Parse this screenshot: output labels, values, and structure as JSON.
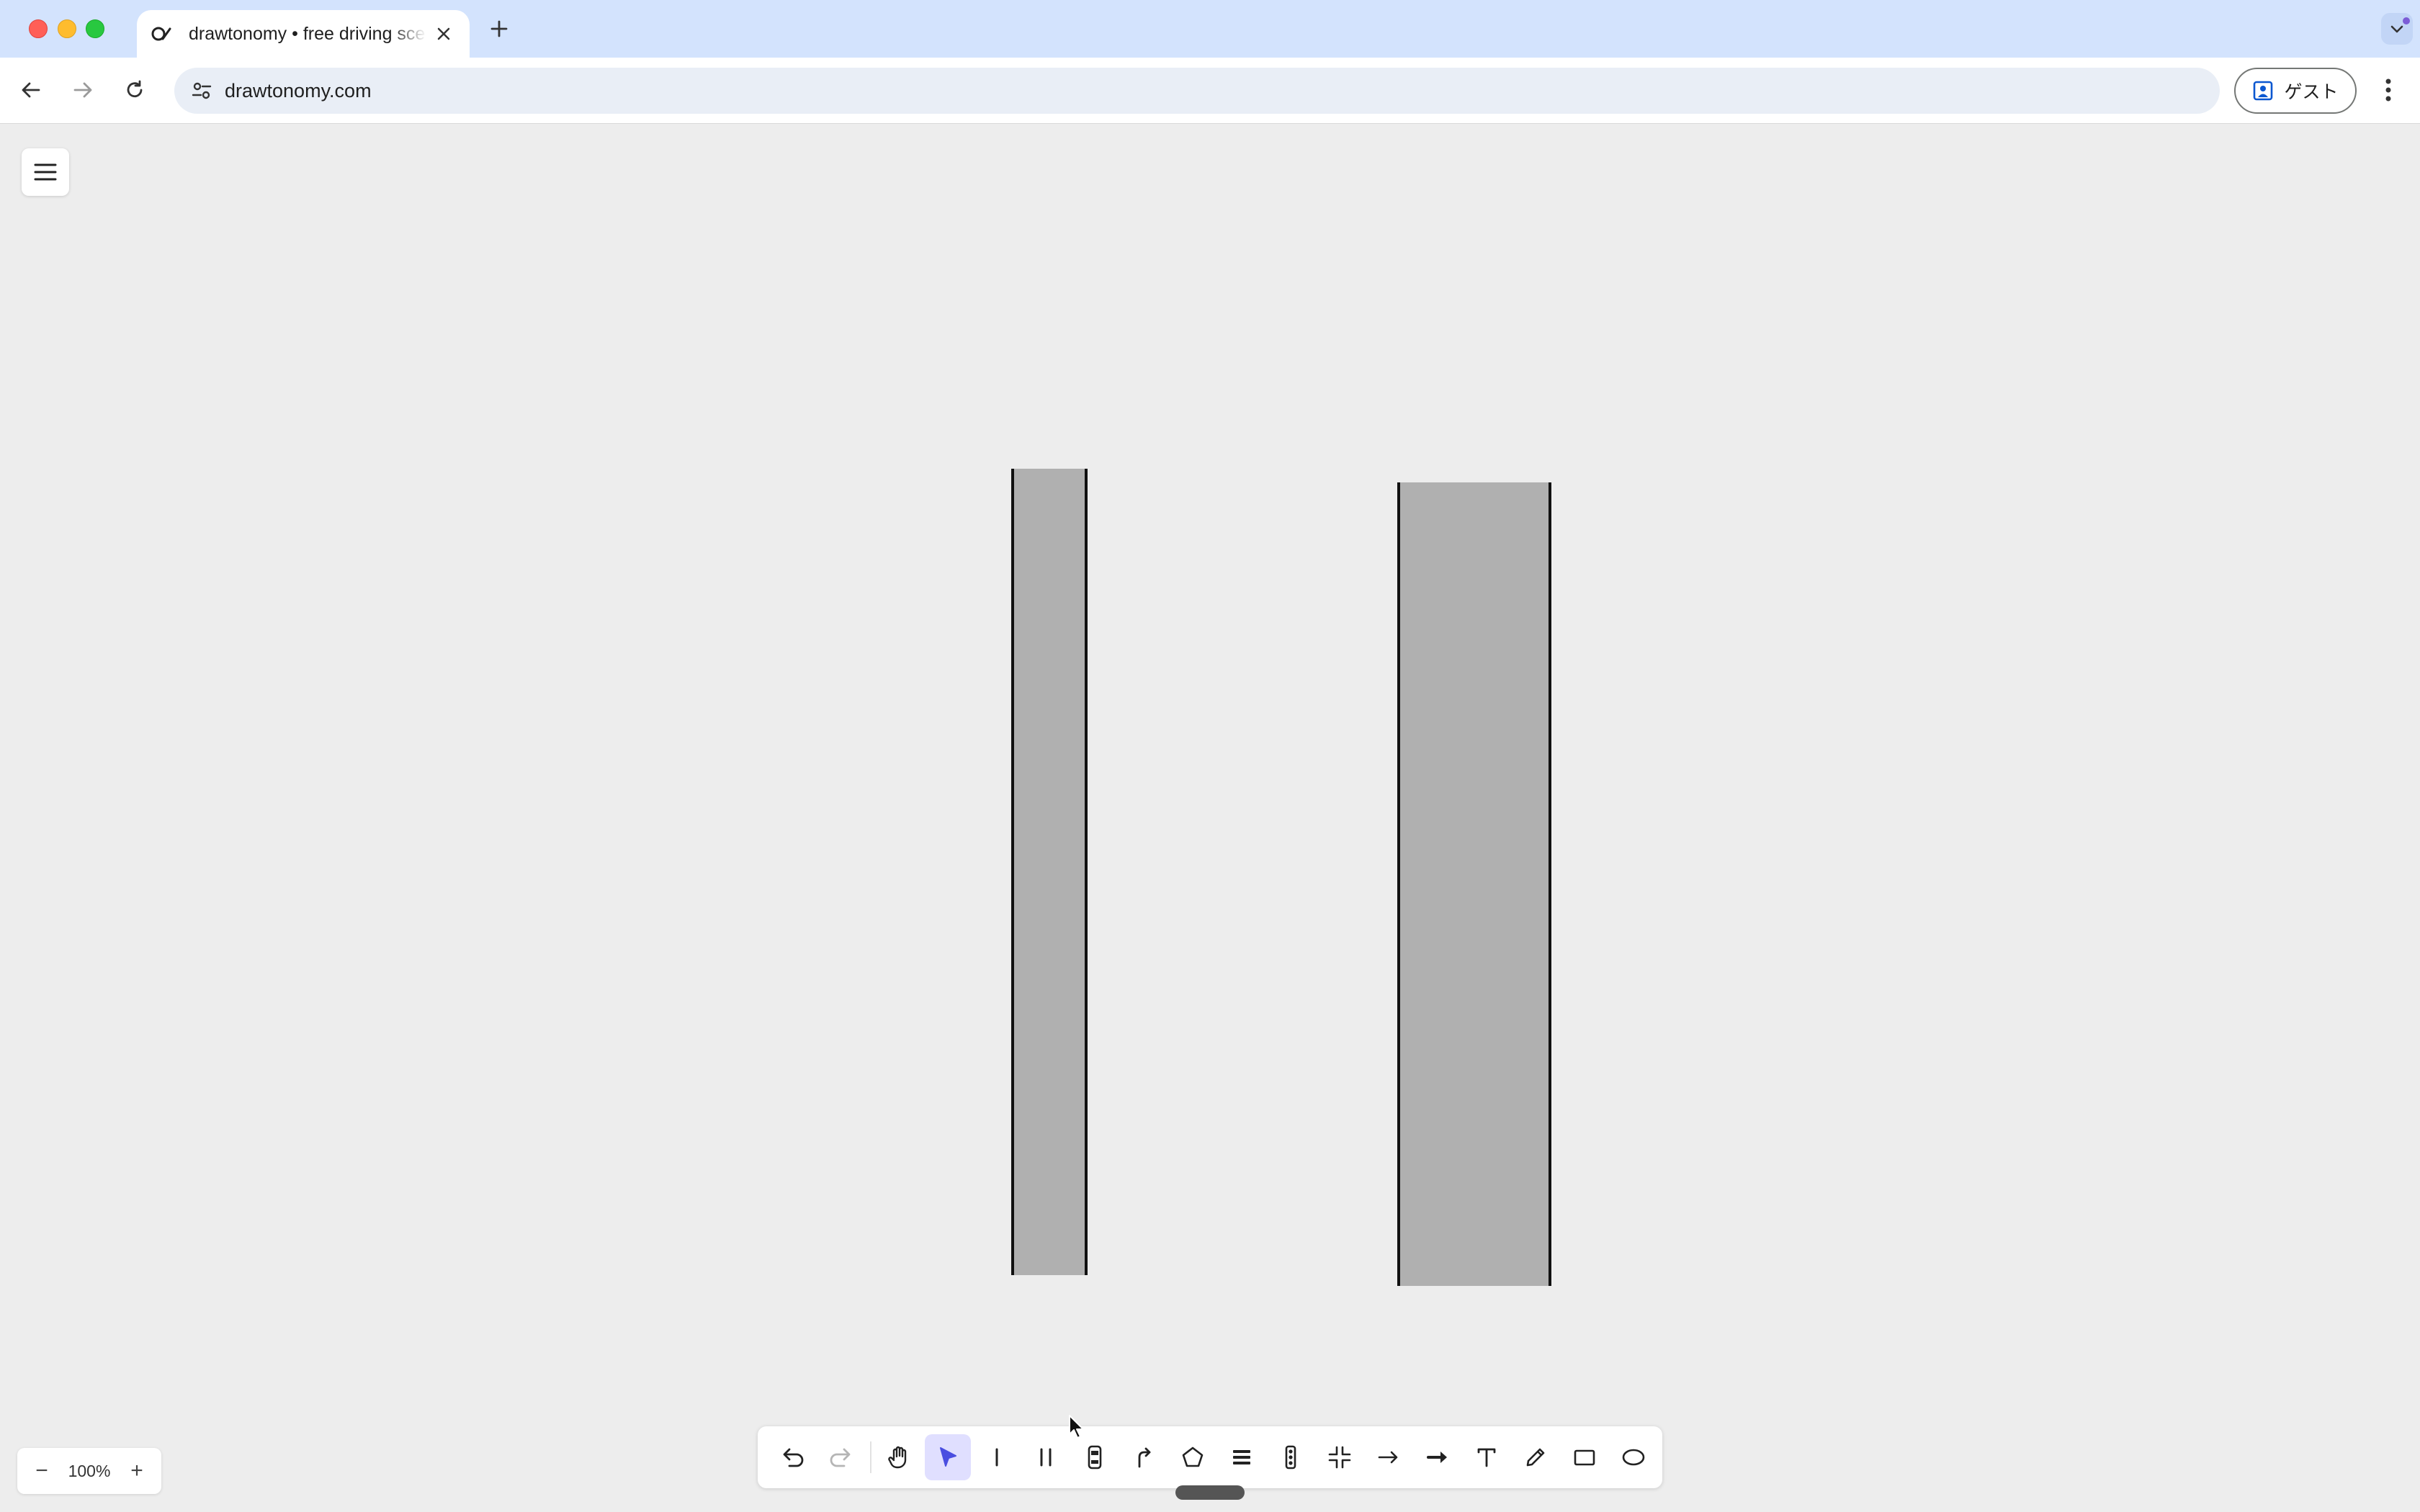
{
  "browser": {
    "tab": {
      "title": "drawtonomy • free driving scene editor",
      "favicon": "drawtonomy-favicon"
    },
    "url": "drawtonomy.com",
    "guest_label": "ゲスト"
  },
  "app": {
    "zoom": {
      "value": "100%",
      "minus": "−",
      "plus": "+"
    },
    "toolbar": {
      "tools": [
        {
          "name": "undo",
          "icon": "undo-icon"
        },
        {
          "name": "redo",
          "icon": "redo-icon"
        },
        {
          "name": "hand",
          "icon": "hand-icon"
        },
        {
          "name": "select",
          "icon": "pointer-icon",
          "active": true
        },
        {
          "name": "single-lane",
          "icon": "single-line-icon"
        },
        {
          "name": "double-lane",
          "icon": "double-line-icon"
        },
        {
          "name": "vehicle",
          "icon": "car-icon"
        },
        {
          "name": "path",
          "icon": "path-icon"
        },
        {
          "name": "polygon",
          "icon": "pentagon-icon"
        },
        {
          "name": "crosswalk",
          "icon": "crosswalk-icon"
        },
        {
          "name": "traffic-light",
          "icon": "traffic-light-icon"
        },
        {
          "name": "intersection",
          "icon": "intersection-icon"
        },
        {
          "name": "arrow",
          "icon": "arrow-icon"
        },
        {
          "name": "thick-arrow",
          "icon": "thick-arrow-icon"
        },
        {
          "name": "text",
          "icon": "text-icon"
        },
        {
          "name": "pencil",
          "icon": "pencil-icon"
        },
        {
          "name": "rectangle",
          "icon": "rectangle-icon"
        },
        {
          "name": "ellipse",
          "icon": "ellipse-icon"
        }
      ]
    },
    "colors": {
      "accent": "#4a4ee0",
      "road_fill": "#b0b0b0",
      "road_edge": "#111111",
      "canvas": "#ededed"
    }
  }
}
